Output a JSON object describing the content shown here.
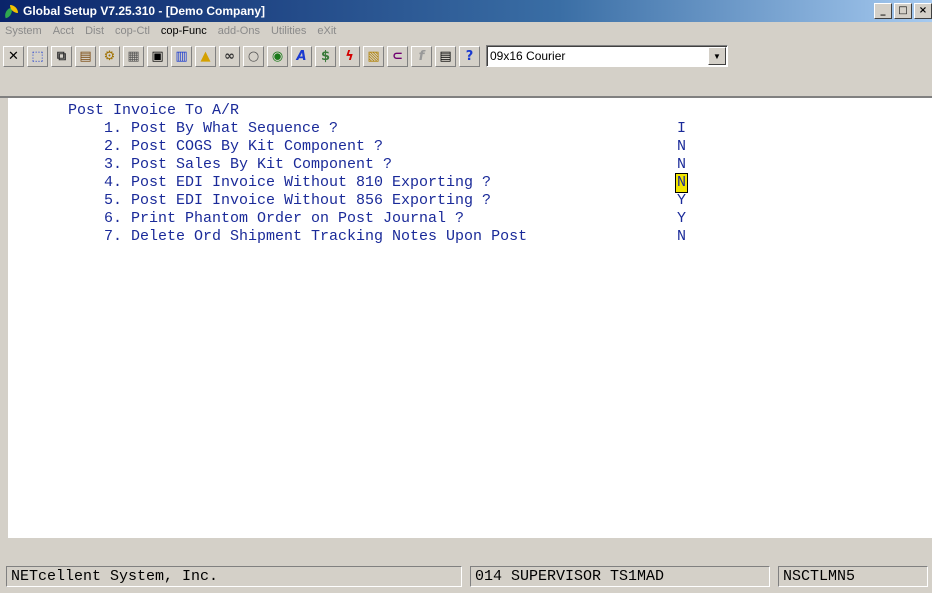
{
  "window": {
    "title": "Global Setup V7.25.310 - [Demo Company]",
    "title_controls": [
      "_",
      "□",
      "×"
    ]
  },
  "menu": [
    {
      "label": "System",
      "enabled": false
    },
    {
      "label": "Acct",
      "enabled": false
    },
    {
      "label": "Dist",
      "enabled": false
    },
    {
      "label": "cop-Ctl",
      "enabled": false
    },
    {
      "label": "cop-Func",
      "enabled": true
    },
    {
      "label": "add-Ons",
      "enabled": false
    },
    {
      "label": "Utilities",
      "enabled": false
    },
    {
      "label": "eXit",
      "enabled": false
    }
  ],
  "toolbar": {
    "icons": [
      "close-icon",
      "select-icon",
      "copy-icon",
      "paste-icon",
      "settings-icon",
      "properties-icon",
      "notes-icon",
      "report-icon",
      "warning-icon",
      "binoculars-icon",
      "zoom-icon",
      "globe-icon",
      "font-icon",
      "money-icon",
      "lightning-icon",
      "calc-icon",
      "link-icon",
      "function-icon",
      "document-icon",
      "help-icon"
    ],
    "font_select": "09x16 Courier"
  },
  "screen": {
    "heading": "Post Invoice To A/R",
    "items": [
      {
        "label": "1. Post By What Sequence ?",
        "value": "I",
        "highlight": false
      },
      {
        "label": "2. Post COGS By Kit Component ?",
        "value": "N",
        "highlight": false
      },
      {
        "label": "3. Post Sales By Kit Component ?",
        "value": "N",
        "highlight": false
      },
      {
        "label": "4. Post EDI Invoice Without 810 Exporting ?",
        "value": "N",
        "highlight": true
      },
      {
        "label": "5. Post EDI Invoice Without 856 Exporting ?",
        "value": "Y",
        "highlight": false
      },
      {
        "label": "6. Print Phantom Order on Post Journal ?",
        "value": "Y",
        "highlight": false
      },
      {
        "label": "7. Delete Ord Shipment Tracking Notes Upon Post",
        "value": "N",
        "highlight": false
      }
    ],
    "text_color": "#1a2a99",
    "highlight_color": "#f2e600"
  },
  "status": {
    "company": "NETcellent System, Inc.",
    "user": "014 SUPERVISOR TS1MAD",
    "program": "NSCTLMN5"
  }
}
